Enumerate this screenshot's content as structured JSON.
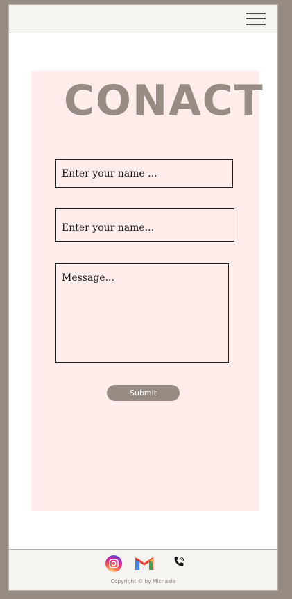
{
  "header": {
    "menu_icon": "hamburger-menu-icon"
  },
  "contact": {
    "title": "CONACT",
    "name_placeholder_1": "Enter your name ...",
    "name_placeholder_2": "Enter your name...",
    "message_placeholder": "Message...",
    "submit_label": "Submit"
  },
  "footer": {
    "icons": [
      "instagram-icon",
      "gmail-icon",
      "phone-icon"
    ],
    "copyright": "Copyright © by Michaela"
  },
  "colors": {
    "page_background": "#978c84",
    "card_background": "#fdecea",
    "accent": "#978c84",
    "bar_background": "#f6f4f1"
  }
}
